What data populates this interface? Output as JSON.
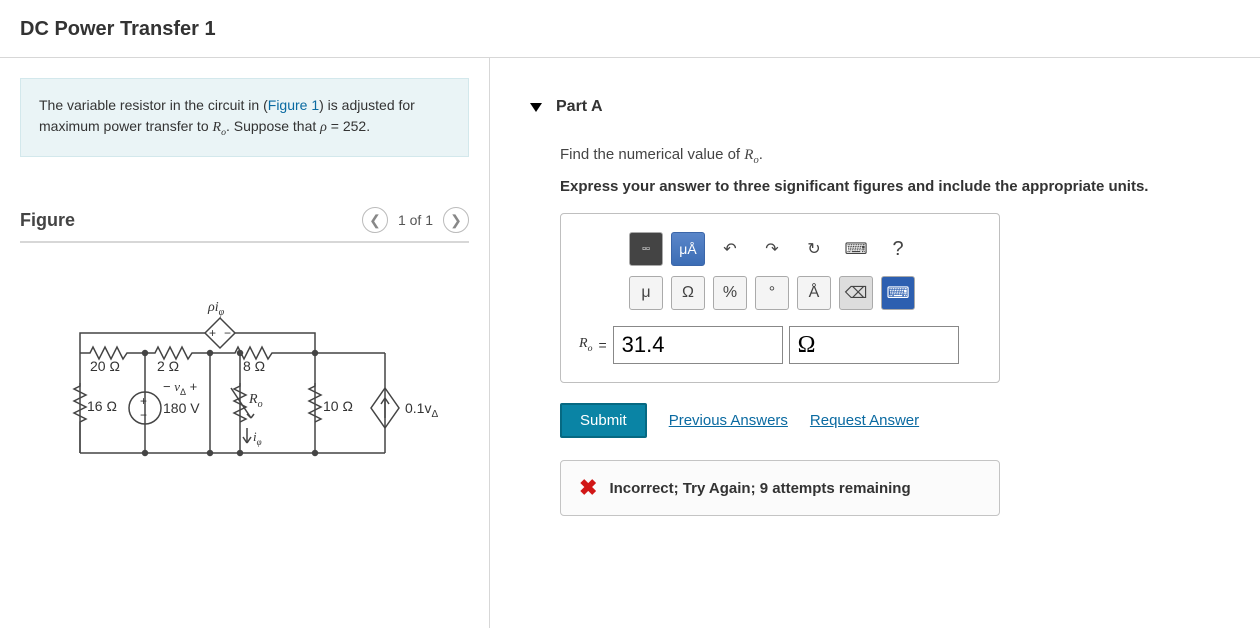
{
  "page_title": "DC Power Transfer 1",
  "problem": {
    "text_pre": "The variable resistor in the circuit in (",
    "figure_link": "Figure 1",
    "text_post_a": ") is adjusted for maximum power transfer to ",
    "Ro": "R",
    "Ro_sub": "o",
    "text_post_b": ". Suppose that ",
    "rho": "ρ",
    "eq": " = 252."
  },
  "figure": {
    "title": "Figure",
    "nav_text": "1 of 1",
    "labels": {
      "rho_i_phi": "ρi",
      "rho_i_phi_sub": "φ",
      "r20": "20 Ω",
      "r2": "2 Ω",
      "r8": "8 Ω",
      "r16": "16 Ω",
      "v180": "180 V",
      "Ro": "R",
      "Ro_sub": "o",
      "r10": "10 Ω",
      "src_right": "0.1v",
      "src_right_sub": "Δ",
      "vdelta": "v",
      "vdelta_sub": "Δ",
      "i_phi": "i",
      "i_phi_sub": "φ"
    }
  },
  "part": {
    "title": "Part A",
    "instruction_pre": "Find the numerical value of ",
    "instruction_sym": "R",
    "instruction_sym_sub": "o",
    "instruction_post": ".",
    "instruction_bold": "Express your answer to three significant figures and include the appropriate units."
  },
  "toolbar": {
    "top": [
      "▫▫",
      "μÅ",
      "↶",
      "↷",
      "↻",
      "⌨",
      "?"
    ],
    "second": [
      "μ",
      "Ω",
      "%",
      "°",
      "Å",
      "⌫",
      "⌨"
    ]
  },
  "answer": {
    "label_pre": "R",
    "label_sub": "o",
    "label_post": " = ",
    "value": "31.4",
    "units": "Ω"
  },
  "actions": {
    "submit": "Submit",
    "previous": "Previous Answers",
    "request": "Request Answer"
  },
  "feedback": {
    "text": "Incorrect; Try Again; 9 attempts remaining"
  }
}
